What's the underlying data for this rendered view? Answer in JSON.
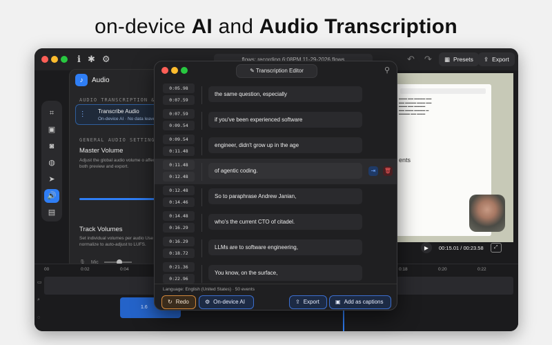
{
  "headline": {
    "light1": "on-device ",
    "bold1": "AI",
    "light2": " and ",
    "bold2": "Audio Transcription"
  },
  "app": {
    "title": "flows: recording 6:08PM 11-29-2026 flows",
    "presets_label": "Presets",
    "export_label": "Export"
  },
  "audio_panel": {
    "title": "Audio",
    "section1": "AUDIO TRANSCRIPTION & A",
    "transcribe_title": "Transcribe Audio",
    "transcribe_sub": "On-device AI · No data leave",
    "section2": "GENERAL AUDIO SETTINGS",
    "master_volume": "Master Volume",
    "master_desc": "Adjust the global audio volume o affect both preview and export.",
    "track_volumes": "Track Volumes",
    "track_desc": "Set individual volumes per audio Use normalize to auto-adjust to LUFS.",
    "mic_label": "Mic"
  },
  "player": {
    "time": "00:15.01 / 00:23.58"
  },
  "timeline": {
    "ticks": [
      "00",
      "0:02",
      "0:04",
      "0:18",
      "0:20",
      "0:22"
    ],
    "clip_label": "1.6"
  },
  "editor": {
    "title": "Transcription Editor",
    "rows": [
      {
        "start": "0:05.98",
        "end": "0:07.59",
        "text": "the same question, especially"
      },
      {
        "start": "0:07.59",
        "end": "0:09.54",
        "text": "if you've been experienced software"
      },
      {
        "start": "0:09.54",
        "end": "0:11.48",
        "text": "engineer, didn't grow up in the age"
      },
      {
        "start": "0:11.48",
        "end": "0:12.48",
        "text": "of agentic coding."
      },
      {
        "start": "0:12.48",
        "end": "0:14.46",
        "text": "So to paraphrase Andrew Janian,"
      },
      {
        "start": "0:14.48",
        "end": "0:16.29",
        "text": "who's the current CTO of citadel."
      },
      {
        "start": "0:16.29",
        "end": "0:18.72",
        "text": "LLMs are to software engineering,"
      },
      {
        "start": "0:21.36",
        "end": "0:22.96",
        "text": "You know, on the surface,"
      }
    ],
    "language_line": "Language: English (United States) · 50 events",
    "redo_label": "Redo",
    "ondevice_label": "On-device AI",
    "export_label": "Export",
    "captions_label": "Add as captions"
  },
  "colors": {
    "accent": "#2f7ef5",
    "redo_border": "#d4893b",
    "delete": "#ff5c5c"
  }
}
